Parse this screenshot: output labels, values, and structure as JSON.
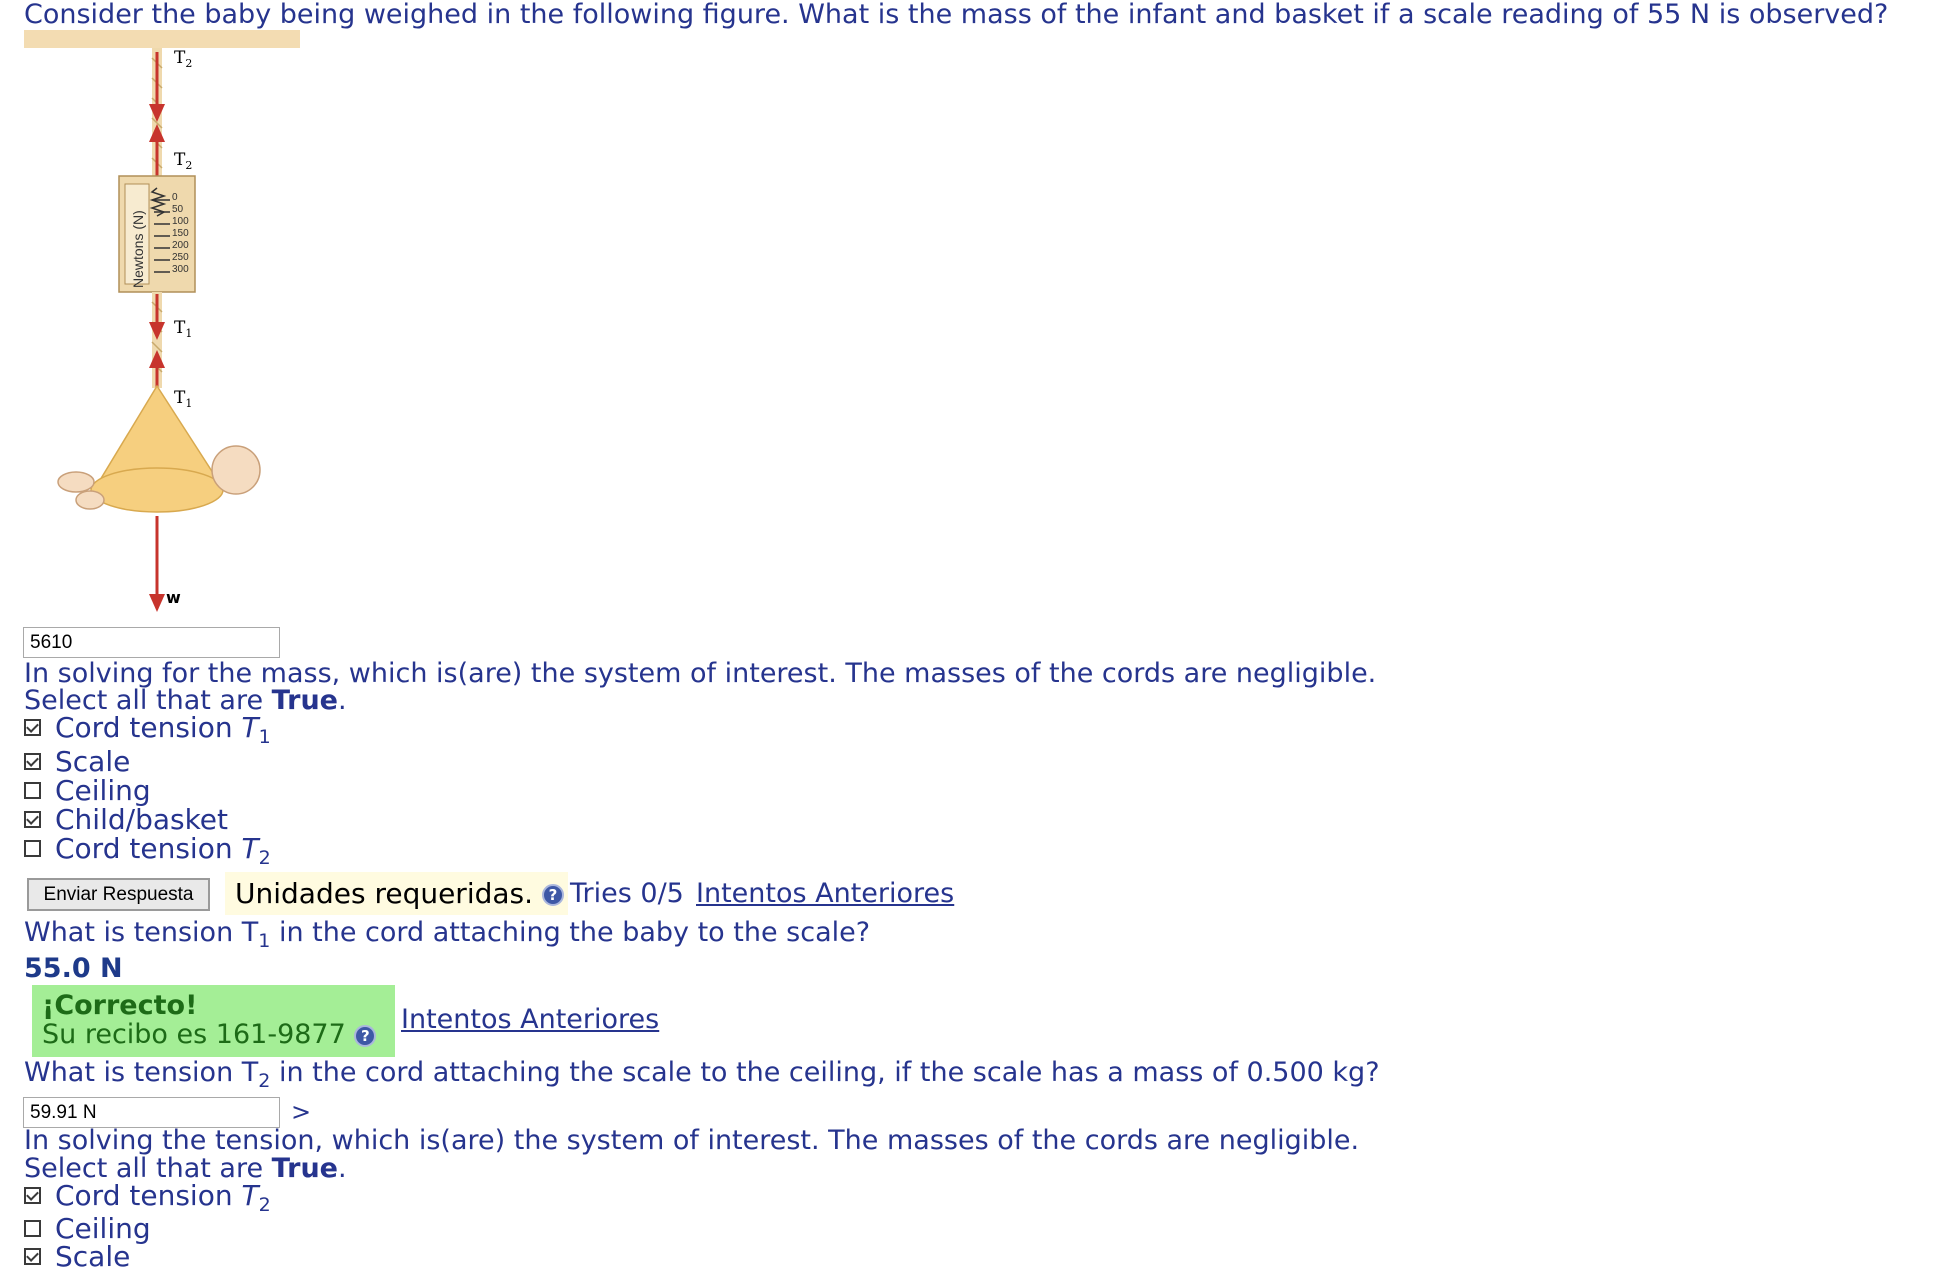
{
  "question": {
    "title": "Consider the baby being weighed in the following figure. What is the mass of the infant and basket if a scale reading of 55 N is observed?"
  },
  "figure": {
    "force_labels": {
      "t2": "T",
      "t2_sub": "2",
      "t1": "T",
      "t1_sub": "1",
      "w": "w"
    },
    "scale_label": "Newtons (N)",
    "scale_ticks": [
      "0",
      "50",
      "100",
      "150",
      "200",
      "250",
      "300"
    ]
  },
  "answer1": {
    "value": "5610"
  },
  "part_a": {
    "prompt": "In solving for the mass, which is(are) the system of interest. The masses of the cords are negligible.",
    "instruction_prefix": "Select all that are ",
    "instruction_bold": "True",
    "instruction_suffix": ".",
    "options": [
      {
        "label": "Cord tension ",
        "var": "T",
        "sub": "1",
        "checked": true
      },
      {
        "label": "Scale",
        "checked": true
      },
      {
        "label": "Ceiling",
        "checked": false
      },
      {
        "label": "Child/basket",
        "checked": true
      },
      {
        "label": "Cord tension ",
        "var": "T",
        "sub": "2",
        "checked": false
      }
    ]
  },
  "submit": {
    "button": "Enviar Respuesta",
    "units_required": "Unidades requeridas.",
    "help_glyph": "?",
    "tries": "Tries 0/5",
    "previous": "Intentos Anteriores"
  },
  "q2": {
    "prompt_pre": "What is tension T",
    "prompt_sub": "1",
    "prompt_post": " in the cord attaching the baby to the scale?",
    "answer": "55.0 N",
    "feedback_title": "¡Correcto!",
    "receipt": "Su recibo es 161-9877",
    "previous": "Intentos Anteriores"
  },
  "q3": {
    "prompt_pre": "What is tension T",
    "prompt_sub": "2",
    "prompt_post": " in the cord attaching the scale to the ceiling, if the scale has a mass of 0.500 kg?",
    "value": "59.91 N",
    "arrow": ">"
  },
  "part_b": {
    "prompt": "In solving the tension, which is(are) the system of interest. The masses of the cords are negligible.",
    "instruction_prefix": "Select all that are ",
    "instruction_bold": "True",
    "instruction_suffix": ".",
    "options": [
      {
        "label": "Cord tension ",
        "var": "T",
        "sub": "2",
        "checked": true
      },
      {
        "label": "Ceiling",
        "checked": false
      },
      {
        "label": "Scale",
        "checked": true
      }
    ]
  }
}
